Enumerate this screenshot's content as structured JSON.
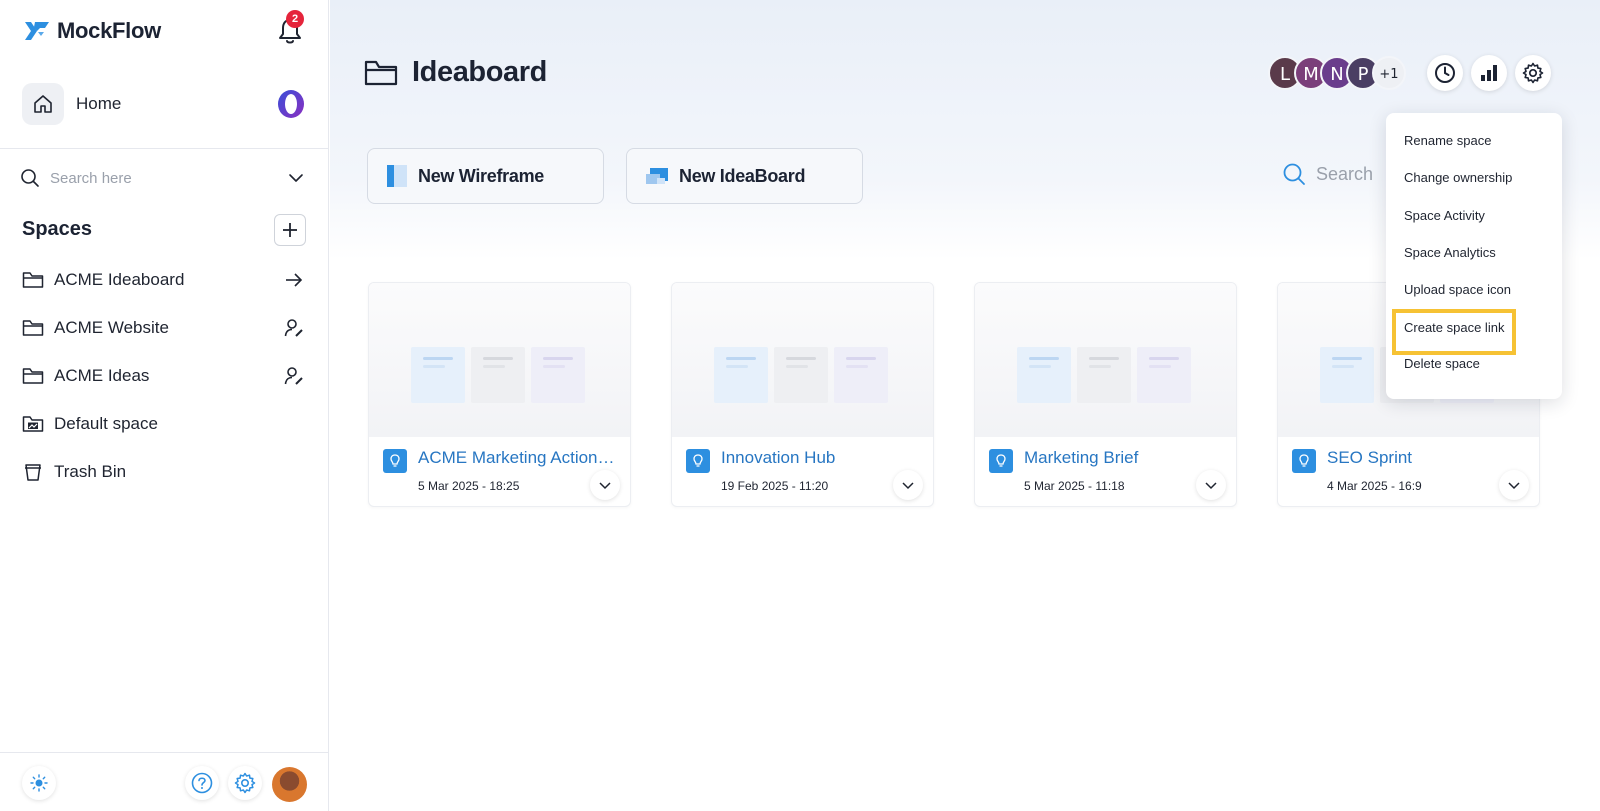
{
  "brand": {
    "name": "MockFlow",
    "accent": "#2d8fe0",
    "highlight": "#f6c234"
  },
  "notifications": {
    "count": "2"
  },
  "sidebar": {
    "home_label": "Home",
    "search_placeholder": "Search here",
    "spaces_title": "Spaces",
    "items": [
      {
        "label": "ACME Ideaboard",
        "icon": "folder-icon",
        "trail": "arrow-right-icon"
      },
      {
        "label": "ACME Website",
        "icon": "folder-icon",
        "trail": "user-edit-icon"
      },
      {
        "label": "ACME Ideas",
        "icon": "folder-icon",
        "trail": "user-edit-icon"
      },
      {
        "label": "Default space",
        "icon": "folder-image-icon"
      },
      {
        "label": "Trash Bin",
        "icon": "trash-icon"
      }
    ]
  },
  "header": {
    "title": "Ideaboard",
    "members": [
      {
        "initial": "L",
        "color": "#5a3a4a"
      },
      {
        "initial": "M",
        "color": "#7b3f7a"
      },
      {
        "initial": "N",
        "color": "#6a3d8c"
      },
      {
        "initial": "P",
        "color": "#4a3e63"
      }
    ],
    "more_members": "+1"
  },
  "actions": {
    "new_wireframe": "New Wireframe",
    "new_ideaboard": "New IdeaBoard",
    "search_placeholder": "Search"
  },
  "boards": [
    {
      "name": "ACME Marketing Action Plan",
      "date": "5 Mar 2025 - 18:25"
    },
    {
      "name": "Innovation Hub",
      "date": "19 Feb 2025 - 11:20"
    },
    {
      "name": "Marketing Brief",
      "date": "5 Mar 2025 - 11:18"
    },
    {
      "name": "SEO Sprint",
      "date": "4 Mar 2025 - 16:9"
    }
  ],
  "settings_menu": {
    "items": [
      "Rename space",
      "Change ownership",
      "Space Activity",
      "Space Analytics",
      "Upload space icon",
      "Create space link",
      "Delete space"
    ],
    "highlighted": "Create space link"
  }
}
